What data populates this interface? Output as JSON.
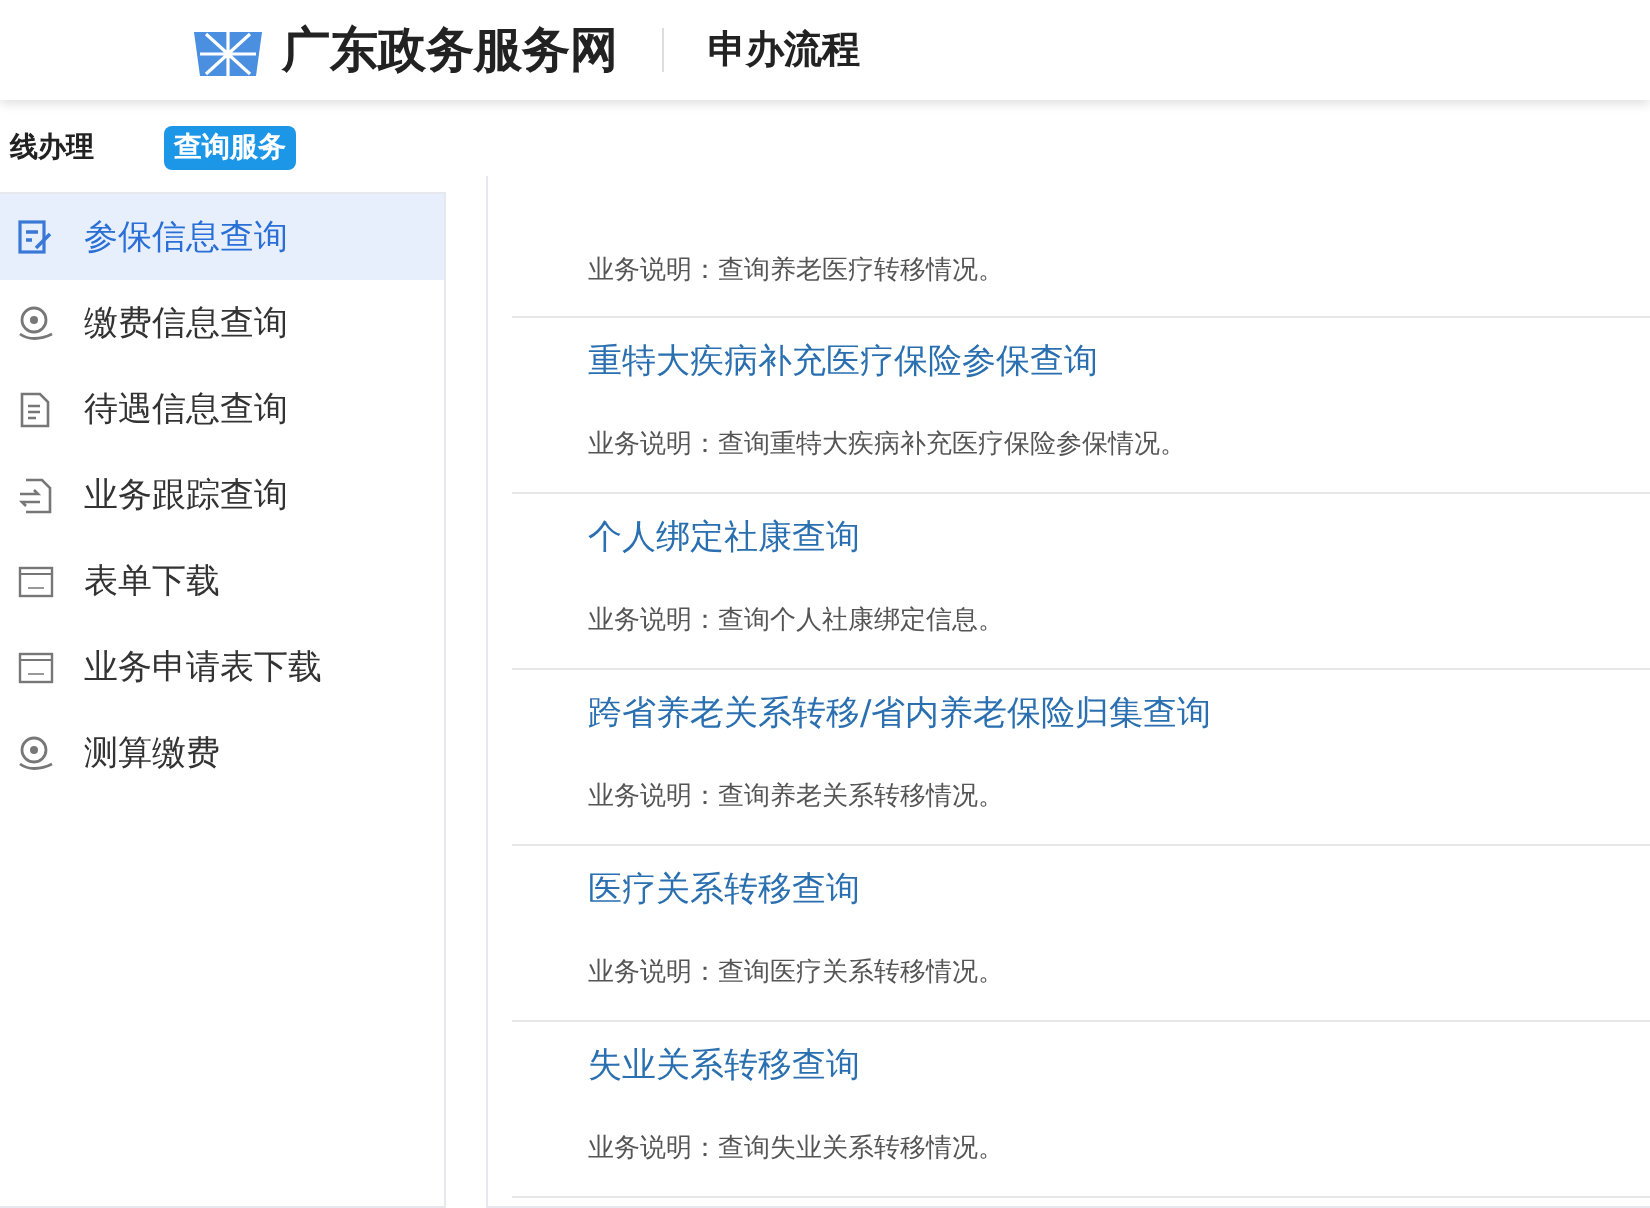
{
  "header": {
    "site_name": "广东政务服务网",
    "section": "申办流程"
  },
  "tabs": [
    {
      "label": "线办理",
      "selected": false
    },
    {
      "label": "查询服务",
      "selected": true
    }
  ],
  "sidebar": {
    "items": [
      {
        "label": "参保信息查询",
        "kind": "edit",
        "selected": true
      },
      {
        "label": "缴费信息查询",
        "kind": "coin",
        "selected": false
      },
      {
        "label": "待遇信息查询",
        "kind": "doc",
        "selected": false
      },
      {
        "label": "业务跟踪查询",
        "kind": "swap",
        "selected": false
      },
      {
        "label": "表单下载",
        "kind": "form",
        "selected": false
      },
      {
        "label": "业务申请表下载",
        "kind": "form",
        "selected": false
      },
      {
        "label": "测算缴费",
        "kind": "coin",
        "selected": false
      }
    ]
  },
  "services": [
    {
      "description": "业务说明：查询养老医疗转移情况。"
    },
    {
      "title": "重特大疾病补充医疗保险参保查询",
      "description": "业务说明：查询重特大疾病补充医疗保险参保情况。"
    },
    {
      "title": "个人绑定社康查询",
      "description": "业务说明：查询个人社康绑定信息。"
    },
    {
      "title": "跨省养老关系转移/省内养老保险归集查询",
      "description": "业务说明：查询养老关系转移情况。"
    },
    {
      "title": "医疗关系转移查询",
      "description": "业务说明：查询医疗关系转移情况。"
    },
    {
      "title": "失业关系转移查询",
      "description": "业务说明：查询失业关系转移情况。"
    }
  ]
}
